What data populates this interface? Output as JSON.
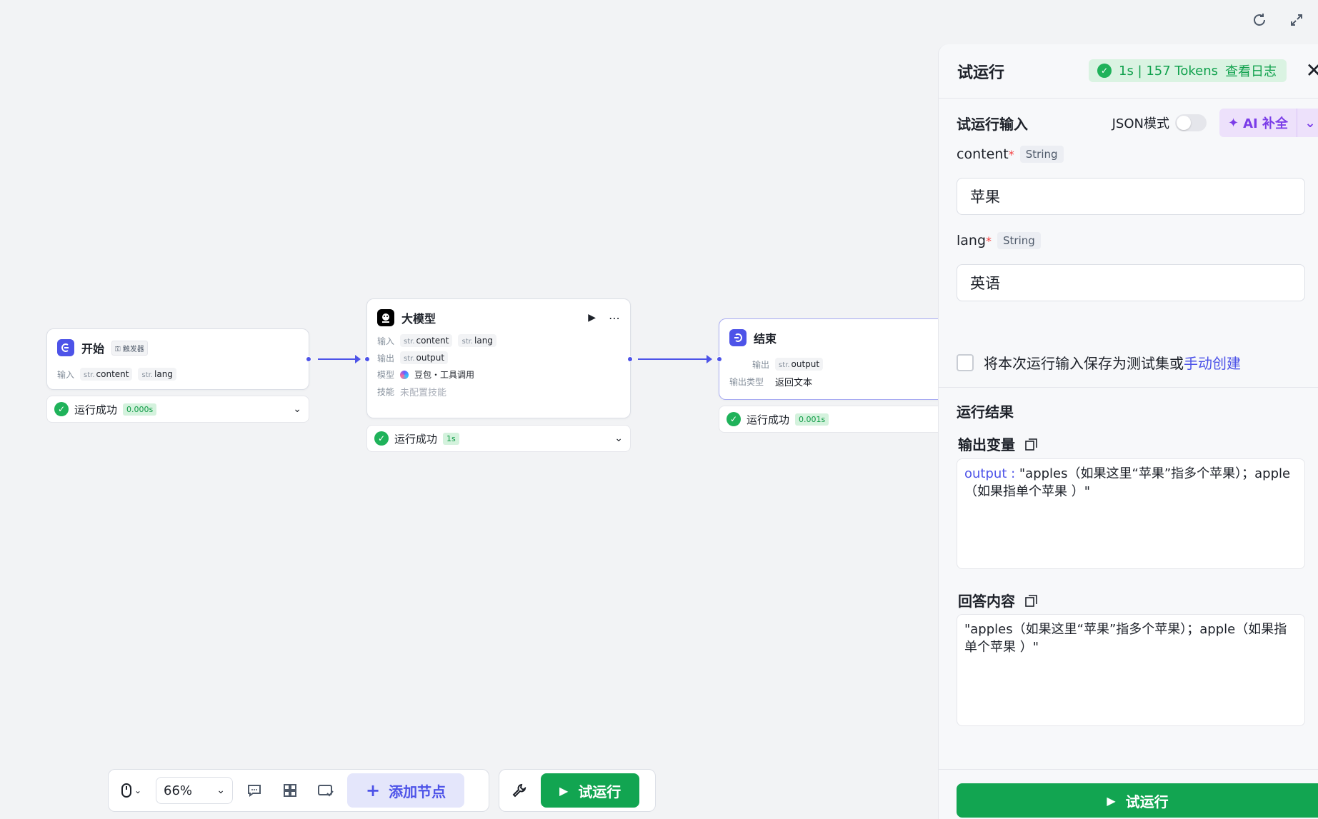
{
  "canvas": {
    "top_icons": [
      "refresh-icon",
      "expand-icon"
    ]
  },
  "nodes": {
    "start": {
      "title": "开始",
      "tag": "触发器",
      "input_label": "输入",
      "inputs": [
        {
          "type": "str.",
          "name": "content"
        },
        {
          "type": "str.",
          "name": "lang"
        }
      ],
      "status": "运行成功",
      "time": "0.000s"
    },
    "llm": {
      "title": "大模型",
      "input_label": "输入",
      "inputs": [
        {
          "type": "str.",
          "name": "content"
        },
        {
          "type": "str.",
          "name": "lang"
        }
      ],
      "output_label": "输出",
      "outputs": [
        {
          "type": "str.",
          "name": "output"
        }
      ],
      "model_label": "模型",
      "model": "豆包・工具调用",
      "skill_label": "技能",
      "skill": "未配置技能",
      "status": "运行成功",
      "time": "1s"
    },
    "end": {
      "title": "结束",
      "output_label": "输出",
      "outputs": [
        {
          "type": "str.",
          "name": "output"
        }
      ],
      "output_type_label": "输出类型",
      "output_type": "返回文本",
      "status": "运行成功",
      "time": "0.001s"
    }
  },
  "toolbar": {
    "zoom": "66%",
    "add_node": "添加节点",
    "run": "试运行"
  },
  "panel": {
    "title": "试运行",
    "badge": "1s | 157 Tokens",
    "view_log": "查看日志",
    "input_section": "试运行输入",
    "json_mode": "JSON模式",
    "ai_fill": "AI 补全",
    "fields": [
      {
        "name": "content",
        "type": "String",
        "value": "苹果"
      },
      {
        "name": "lang",
        "type": "String",
        "value": "英语"
      }
    ],
    "save_text": "将本次运行输入保存为测试集或",
    "save_link": "手动创建",
    "result_section": "运行结果",
    "output_var_label": "输出变量",
    "output_key": "output",
    "output_sep": " : ",
    "output_value": "\"apples（如果这里“苹果”指多个苹果）；apple（如果指单个苹果 ）\"",
    "answer_label": "回答内容",
    "answer_value": "\"apples（如果这里“苹果”指多个苹果）；apple（如果指单个苹果 ）\"",
    "run_button": "试运行"
  },
  "colors": {
    "accent": "#4d53e8",
    "success": "#12a551",
    "ai": "#7b3de8"
  }
}
